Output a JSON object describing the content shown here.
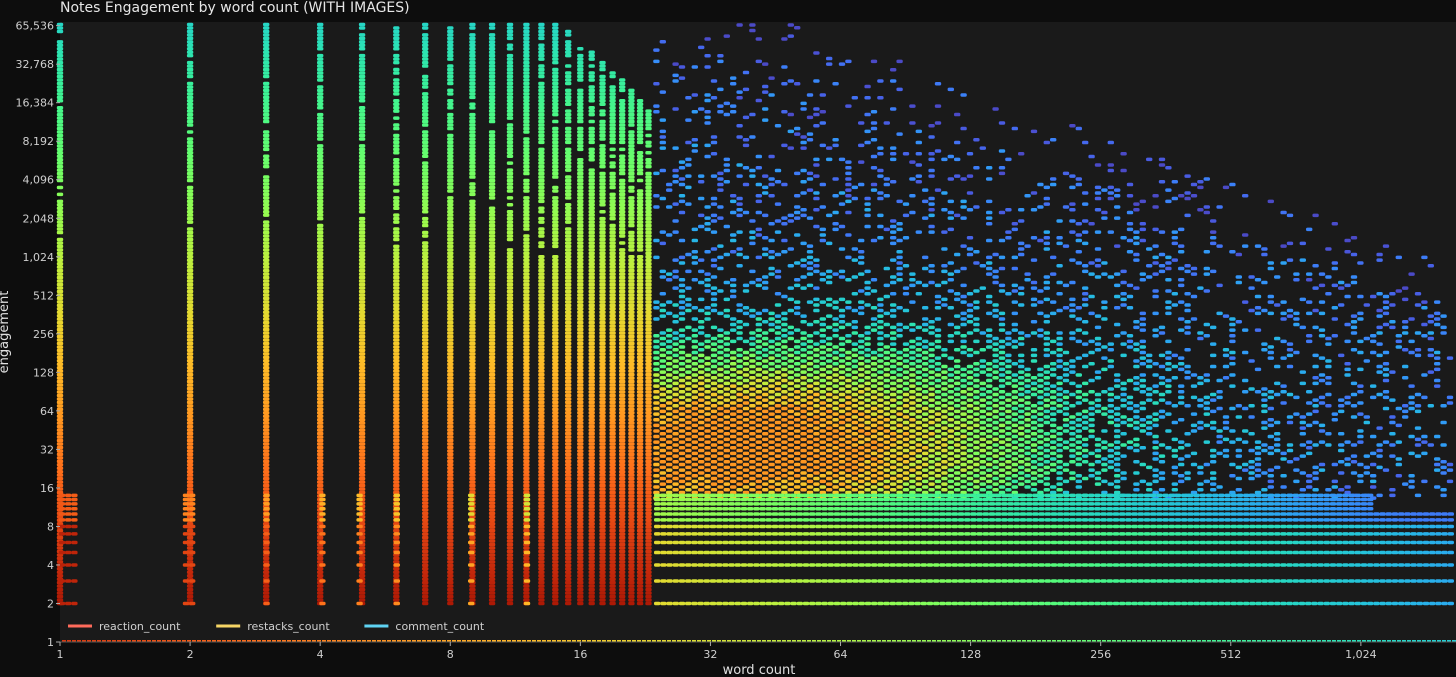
{
  "chart_data": {
    "type": "heatmap",
    "subtype": "hexbin",
    "title": "Notes Engagement by word count (WITH IMAGES)",
    "xlabel": "word count",
    "ylabel": "engagement",
    "x_scale": "log2",
    "y_scale": "log2",
    "xlim": [
      1,
      1700
    ],
    "ylim": [
      1,
      70000
    ],
    "x_ticks": [
      1,
      2,
      4,
      8,
      16,
      32,
      64,
      128,
      256,
      512,
      1024
    ],
    "x_tick_labels": [
      "1",
      "2",
      "4",
      "8",
      "16",
      "32",
      "64",
      "128",
      "256",
      "512",
      "1,024"
    ],
    "y_ticks": [
      1,
      2,
      4,
      8,
      16,
      32,
      64,
      128,
      256,
      512,
      1024,
      2048,
      4096,
      8192,
      16384,
      32768,
      65536
    ],
    "y_tick_labels": [
      "1",
      "2",
      "4",
      "8",
      "16",
      "32",
      "64",
      "128",
      "256",
      "512",
      "1,024",
      "2,048",
      "4,096",
      "8,192",
      "16,384",
      "32,768",
      "65,536"
    ],
    "grid": false,
    "legend_position": "bottom-left",
    "colormap": "turbo",
    "colors": {
      "background": "#0d0d0d",
      "plot_background": "#1a1a1a"
    },
    "series": [
      {
        "name": "reaction_count",
        "color": "#ff6b5b"
      },
      {
        "name": "restacks_count",
        "color": "#f6d565"
      },
      {
        "name": "comment_count",
        "color": "#5fd3f3"
      }
    ],
    "density_regions": [
      {
        "description": "discrete columns at low word counts",
        "x_range": [
          1,
          24
        ],
        "y_range": [
          2,
          65536
        ]
      },
      {
        "description": "dense core",
        "x_range": [
          24,
          700
        ],
        "y_range": [
          16,
          4096
        ]
      },
      {
        "description": "discrete engagement rows",
        "x_range": [
          1,
          1700
        ],
        "y_range": [
          1,
          14
        ]
      }
    ]
  }
}
